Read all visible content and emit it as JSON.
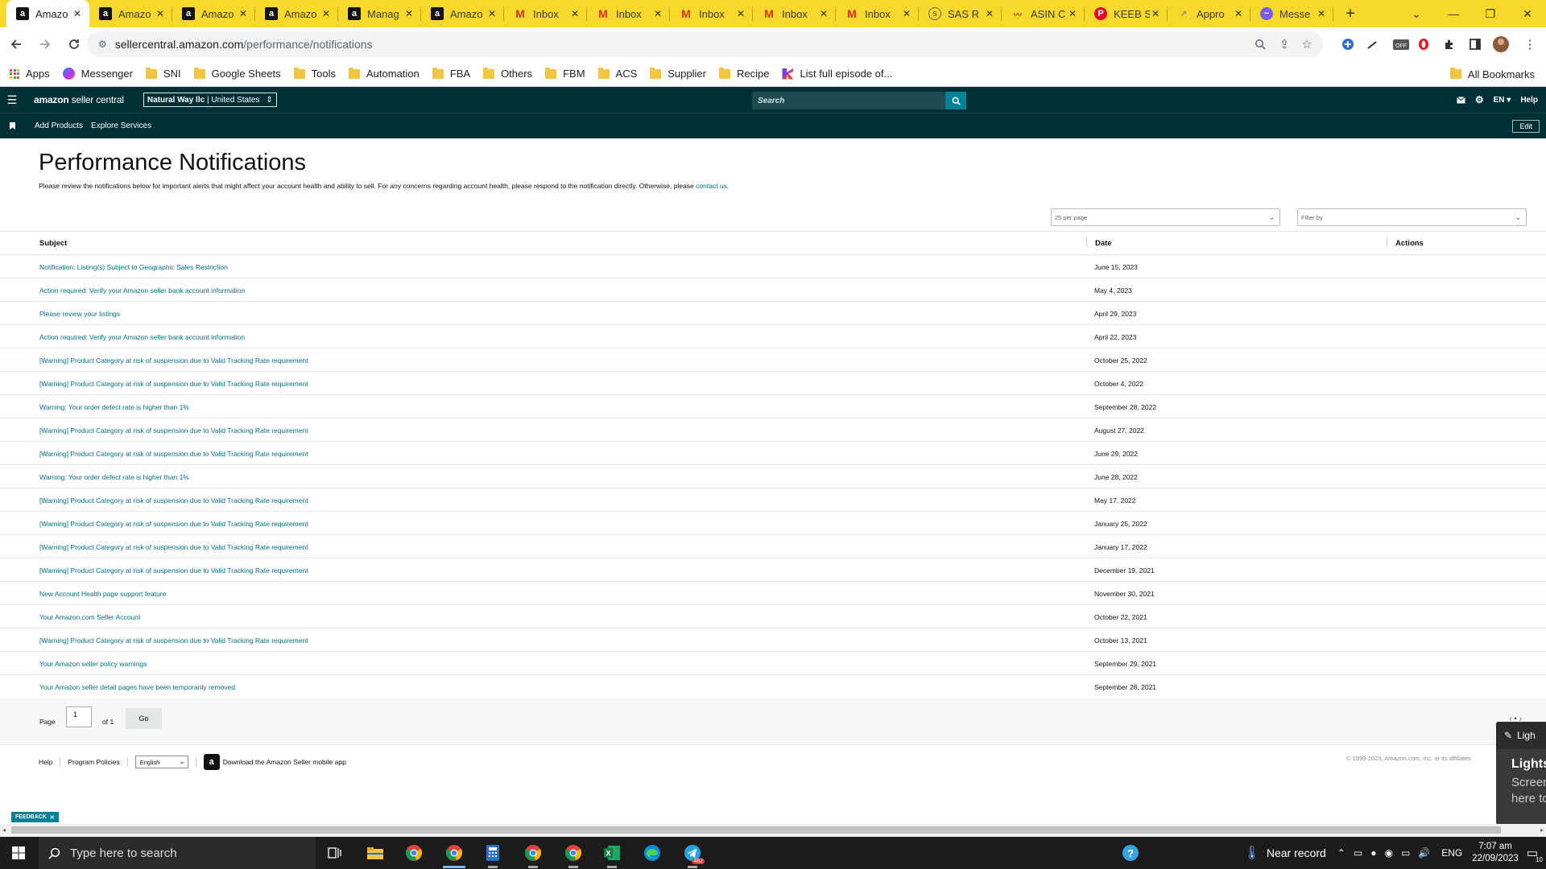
{
  "browser": {
    "tabs": [
      {
        "label": "Amazo",
        "icon": "amazon",
        "active": true
      },
      {
        "label": "Amazo",
        "icon": "amazon"
      },
      {
        "label": "Amazo",
        "icon": "amazon"
      },
      {
        "label": "Amazo",
        "icon": "amazon"
      },
      {
        "label": "Manag",
        "icon": "amazon"
      },
      {
        "label": "Amazo",
        "icon": "amazon"
      },
      {
        "label": "Inbox",
        "icon": "gmail"
      },
      {
        "label": "Inbox",
        "icon": "gmail"
      },
      {
        "label": "Inbox",
        "icon": "gmail"
      },
      {
        "label": "Inbox",
        "icon": "gmail"
      },
      {
        "label": "Inbox",
        "icon": "gmail"
      },
      {
        "label": "SAS R",
        "icon": "sas"
      },
      {
        "label": "ASIN C",
        "icon": "asin"
      },
      {
        "label": "KEEB S",
        "icon": "keeb"
      },
      {
        "label": "Appro",
        "icon": "appr"
      },
      {
        "label": "Messe",
        "icon": "messenger"
      }
    ],
    "url_host": "sellercentral.amazon.com",
    "url_path": "/performance/notifications",
    "bookmarks": [
      {
        "label": "Apps",
        "type": "apps"
      },
      {
        "label": "Messenger",
        "type": "messenger"
      },
      {
        "label": "SNI",
        "type": "folder"
      },
      {
        "label": "Google Sheets",
        "type": "folder"
      },
      {
        "label": "Tools",
        "type": "folder"
      },
      {
        "label": "Automation",
        "type": "folder"
      },
      {
        "label": "FBA",
        "type": "folder"
      },
      {
        "label": "Others",
        "type": "folder"
      },
      {
        "label": "FBM",
        "type": "folder"
      },
      {
        "label": "ACS",
        "type": "folder"
      },
      {
        "label": "Supplier",
        "type": "folder"
      },
      {
        "label": "Recipe",
        "type": "folder"
      },
      {
        "label": "List full episode of...",
        "type": "kodi"
      }
    ],
    "all_bookmarks": "All Bookmarks"
  },
  "header": {
    "logo_brand": "amazon",
    "logo_product": "seller central",
    "account": "Natural Way llc",
    "marketplace": "United States",
    "search_placeholder": "Search",
    "lang": "EN",
    "help": "Help"
  },
  "subnav": {
    "items": [
      "Add Products",
      "Explore Services"
    ],
    "edit": "Edit"
  },
  "page": {
    "title": "Performance Notifications",
    "description": "Please review the notifications below for important alerts that might affect your account health and ability to sell. For any concerns regarding account health, please respond to the notification directly. Otherwise, please",
    "contact_link": "contact us.",
    "per_page": "25 per page",
    "filter_placeholder": "Filter by"
  },
  "table": {
    "columns": [
      "Subject",
      "Date",
      "Actions"
    ],
    "rows": [
      {
        "subject": "Notification: Listing(s) Subject to Geographic Sales Restriction",
        "date": "June 15, 2023"
      },
      {
        "subject": "Action required: Verify your Amazon seller bank account information",
        "date": "May 4, 2023"
      },
      {
        "subject": "Please review your listings",
        "date": "April 29, 2023"
      },
      {
        "subject": "Action required: Verify your Amazon seller bank account information",
        "date": "April 22, 2023"
      },
      {
        "subject": "[Warning] Product Category at risk of suspension due to Valid Tracking Rate requirement",
        "date": "October 25, 2022"
      },
      {
        "subject": "[Warning] Product Category at risk of suspension due to Valid Tracking Rate requirement",
        "date": "October 4, 2022"
      },
      {
        "subject": "Warning: Your order defect rate is higher than 1%",
        "date": "September 28, 2022"
      },
      {
        "subject": "[Warning] Product Category at risk of suspension due to Valid Tracking Rate requirement",
        "date": "August 27, 2022"
      },
      {
        "subject": "[Warning] Product Category at risk of suspension due to Valid Tracking Rate requirement",
        "date": "June 29, 2022"
      },
      {
        "subject": "Warning: Your order defect rate is higher than 1%",
        "date": "June 28, 2022"
      },
      {
        "subject": "[Warning] Product Category at risk of suspension due to Valid Tracking Rate requirement",
        "date": "May 17, 2022"
      },
      {
        "subject": "[Warning] Product Category at risk of suspension due to Valid Tracking Rate requirement",
        "date": "January 25, 2022"
      },
      {
        "subject": "[Warning] Product Category at risk of suspension due to Valid Tracking Rate requirement",
        "date": "January 17, 2022"
      },
      {
        "subject": "[Warning] Product Category at risk of suspension due to Valid Tracking Rate requirement",
        "date": "December 19, 2021"
      },
      {
        "subject": "New Account Health page support feature",
        "date": "November 30, 2021"
      },
      {
        "subject": "Your Amazon.com Seller Account",
        "date": "October 22, 2021"
      },
      {
        "subject": "[Warning] Product Category at risk of suspension due to Valid Tracking Rate requirement",
        "date": "October 13, 2021"
      },
      {
        "subject": "Your Amazon seller policy warnings",
        "date": "September 29, 2021"
      },
      {
        "subject": "Your Amazon seller detail pages have been temporarily removed",
        "date": "September 28, 2021"
      }
    ]
  },
  "pager": {
    "label": "Page",
    "current": "1",
    "of_total": "of 1",
    "go": "Go"
  },
  "footer": {
    "help": "Help",
    "program_policies": "Program Policies",
    "language": "English",
    "app_download": "Download the Amazon Seller mobile app",
    "copyright": "© 1999-2023, Amazon.com, Inc. or its affiliates"
  },
  "lightshot": {
    "head": "Ligh",
    "title": "Lightsh",
    "body_line1": "Screen",
    "body_line2": "here to"
  },
  "feedback": "FEEDBACK",
  "taskbar": {
    "search_placeholder": "Type here to search",
    "telegram_badge": "482",
    "weather": "Near record",
    "lang": "ENG",
    "time": "7:07 am",
    "date": "22/09/2023",
    "notifications": "10"
  },
  "colors": {
    "tabstrip": "#f7d82b",
    "header_bg": "#002f36",
    "link": "#007185",
    "search_btn": "#008296"
  }
}
